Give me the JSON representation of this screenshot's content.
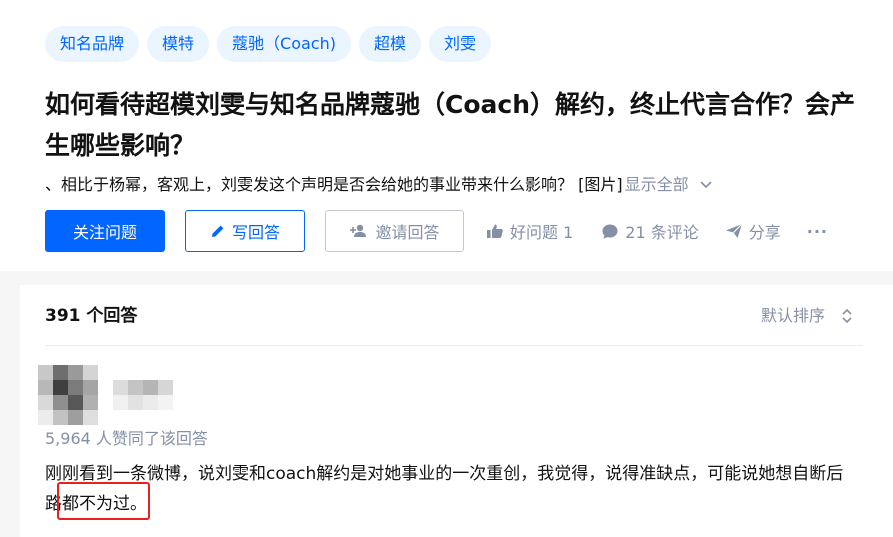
{
  "topics": [
    "知名品牌",
    "模特",
    "蔻驰（Coach)",
    "超模",
    "刘雯"
  ],
  "question": {
    "title": "如何看待超模刘雯与知名品牌蔻驰（Coach）解约，终止代言合作？会产生哪些影响？",
    "detail": "、相比于杨幂，客观上，刘雯发这个声明是否会给她的事业带来什么影响？ [图片]",
    "show_all": "显示全部"
  },
  "actions": {
    "follow": "关注问题",
    "write": "写回答",
    "invite": "邀请回答",
    "good_question": "好问题 1",
    "comments": "21 条评论",
    "share": "分享",
    "more": "···"
  },
  "answers": {
    "count_label": "391 个回答",
    "sort_label": "默认排序"
  },
  "answer": {
    "likes": "5,964 人赞同了该回答",
    "content": "刚刚看到一条微博，说刘雯和coach解约是对她事业的一次重创，我觉得，说得准缺点，可能说她想自断后路都不为过。"
  },
  "colors": {
    "accent": "#0066ff",
    "tag_bg": "#ebf5ff",
    "muted": "#8590a6",
    "highlight": "#e8211d"
  },
  "icons": {
    "write": "pencil-icon",
    "invite": "add-user-icon",
    "good": "thumbs-up-icon",
    "comment": "comment-bubble-icon",
    "share": "paper-plane-icon",
    "sort": "up-down-chevron-icon",
    "expand": "chevron-down-icon"
  }
}
